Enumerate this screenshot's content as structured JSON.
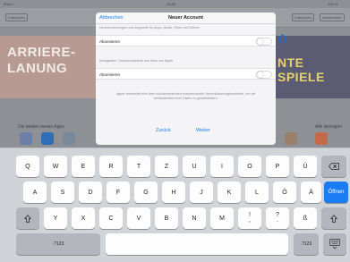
{
  "background": {
    "status_left": "iPad ≈",
    "status_center": "19:43",
    "status_right": "100 %",
    "nav_left": "Kategorien",
    "nav_right_1": "Kategorien",
    "nav_right_2": "Wunschliste",
    "banner_left_lines": [
      "ARRIERE-",
      "LANUNG"
    ],
    "banner_right_lines": [
      "NTE",
      "SPIELE"
    ],
    "row_label_left": "Die besten neuen Apps",
    "row_label_right": "Alle anzeigen",
    "tile_colors": [
      "#6b7fa8",
      "#2e6fb8",
      "#7a8a9a",
      "#9a7f6a",
      "#c46a4a"
    ]
  },
  "modal": {
    "cancel_label": "Abbrechen",
    "title": "Neuer Account",
    "caption_1": "Neuerscheinungen und Angebote für Apps, Musik, Filme und Bücher",
    "cell_1_label": "Abonnieren",
    "caption_2": "Neuigkeiten, Sonderangebote und Infos von Apple",
    "cell_2_label": "Abonnieren",
    "info_text": "Apple verwendet eine dem Industriestandard entsprechende Verschlüsselungsmethode, um die Vertraulichkeit Ihrer Daten zu gewährleisten.",
    "back_label": "Zurück",
    "next_label": "Weiter",
    "toggle_1_on": false,
    "toggle_2_on": false
  },
  "keyboard": {
    "row1": [
      "Q",
      "W",
      "E",
      "R",
      "T",
      "Z",
      "U",
      "I",
      "O",
      "P",
      "Ü"
    ],
    "row2": [
      "A",
      "S",
      "D",
      "F",
      "G",
      "H",
      "J",
      "K",
      "L",
      "Ö",
      "Ä"
    ],
    "row3": [
      "Y",
      "X",
      "C",
      "V",
      "B",
      "N",
      "M"
    ],
    "row3_punct_1": [
      "!",
      ","
    ],
    "row3_punct_2": [
      "?",
      "."
    ],
    "row3_extra": "ß",
    "return_label": "Öffnen",
    "numbers_label": ".?123",
    "numbers_label_right": ".?123",
    "backspace_icon": "backspace-icon",
    "shift_icon": "shift-icon",
    "hide_keyboard_icon": "hide-keyboard-icon",
    "accent_color": "#1a7cf5"
  }
}
